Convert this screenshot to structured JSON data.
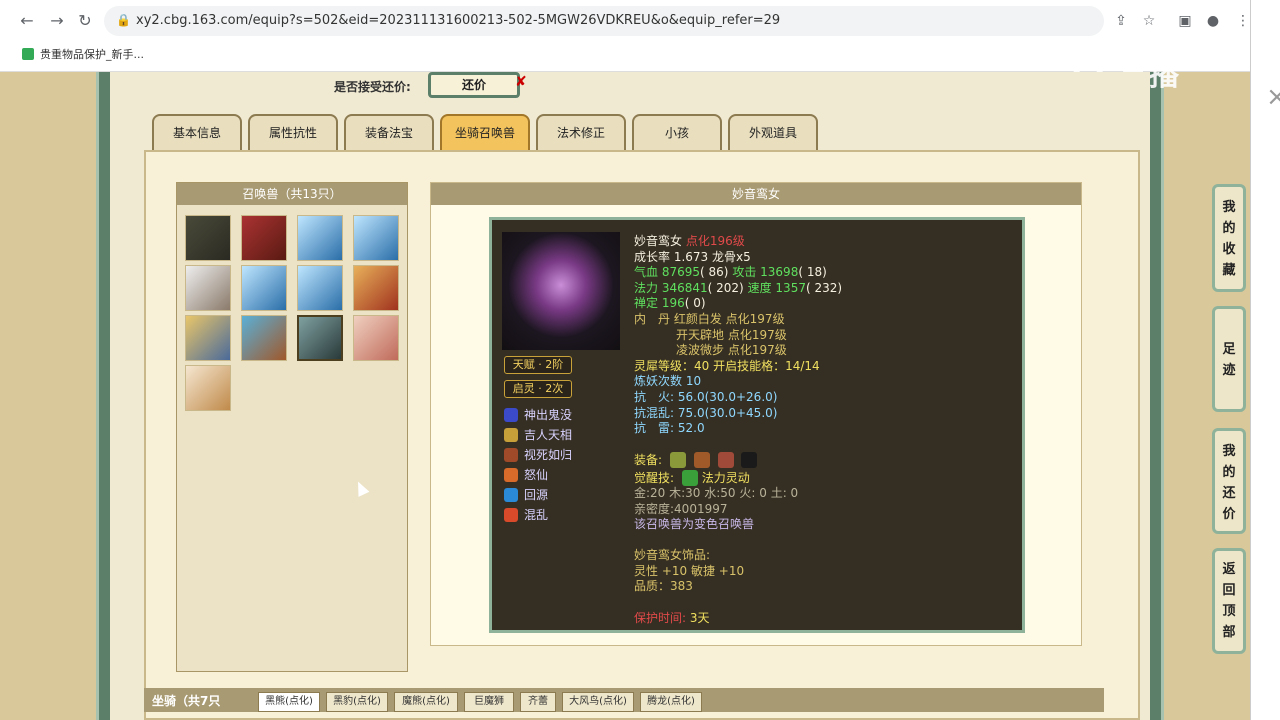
{
  "browser": {
    "url": "xy2.cbg.163.com/equip?s=502&eid=202311131600213-502-5MGW26VDKREU&o&equip_refer=29",
    "bookmark": "贵重物品保护_新手..."
  },
  "watermark": "CC直播",
  "haggle": {
    "label": "是否接受还价:",
    "button": "还价"
  },
  "tabs": [
    "基本信息",
    "属性抗性",
    "装备法宝",
    "坐骑召唤兽",
    "法术修正",
    "小孩",
    "外观道具"
  ],
  "active_tab": "坐骑召唤兽",
  "pet_list": {
    "title": "召唤兽（共13只）",
    "pets": [
      "pet-1",
      "pet-2",
      "pet-3",
      "pet-4",
      "pet-5",
      "pet-6",
      "pet-7",
      "pet-8",
      "pet-9",
      "pet-10",
      "pet-11",
      "pet-12",
      "pet-13"
    ]
  },
  "detail": {
    "title": "妙音鸾女",
    "badges": [
      "天赋 · 2阶",
      "启灵 · 2次"
    ],
    "skills": [
      "神出鬼没",
      "吉人天相",
      "视死如归",
      "怒仙",
      "回源",
      "混乱"
    ],
    "name": "妙音鸾女",
    "rebirth": "点化196级",
    "growth": "成长率 1.673 龙骨x5",
    "hp_label": "气血",
    "hp": "87695",
    "hp_pts": "( 86)",
    "atk_label": "攻击",
    "atk": "13698",
    "atk_pts": "( 18)",
    "mp_label": "法力",
    "mp": "346841",
    "mp_pts": "( 202)",
    "spd_label": "速度",
    "spd": "1357",
    "spd_pts": "( 232)",
    "zen_label": "禅定",
    "zen": "196",
    "zen_pts": "( 0)",
    "neidan_label": "内　丹",
    "neidan": [
      "红颜白发 点化197级",
      "开天辟地 点化197级",
      "凌波微步 点化197级"
    ],
    "lingxi": "灵犀等级：40 开启技能格：14/14",
    "lianyao": "炼妖次数 10",
    "resist_fire_label": "抗　火:",
    "resist_fire": "56.0(30.0+26.0)",
    "resist_chaos_label": "抗混乱:",
    "resist_chaos": "75.0(30.0+45.0)",
    "resist_thunder_label": "抗　雷:",
    "resist_thunder": "52.0",
    "equip_label": "装备:",
    "awaken_label": "觉醒技:",
    "awaken": "法力灵动",
    "elements": "金:20 木:30 水:50 火: 0 土: 0",
    "intimacy": "亲密度:4001997",
    "variant": "该召唤兽为变色召唤兽",
    "ornament_title": "妙音鸾女饰品:",
    "ornament_stats": "灵性 +10 敏捷 +10",
    "ornament_quality": "品质：383",
    "protect_label": "保护时间:",
    "protect_time": "3天"
  },
  "mounts": {
    "label": "坐骑（共7只",
    "tabs": [
      "黑熊(点化)",
      "黑豹(点化)",
      "魔熊(点化)",
      "巨魔狮",
      "齐蕾",
      "大风鸟(点化)",
      "腾龙(点化)"
    ]
  },
  "side_buttons": [
    [
      "我",
      "的",
      "收",
      "藏"
    ],
    [
      "足",
      "迹"
    ],
    [
      "我",
      "的",
      "还",
      "价"
    ],
    [
      "返",
      "回",
      "顶",
      "部"
    ]
  ]
}
